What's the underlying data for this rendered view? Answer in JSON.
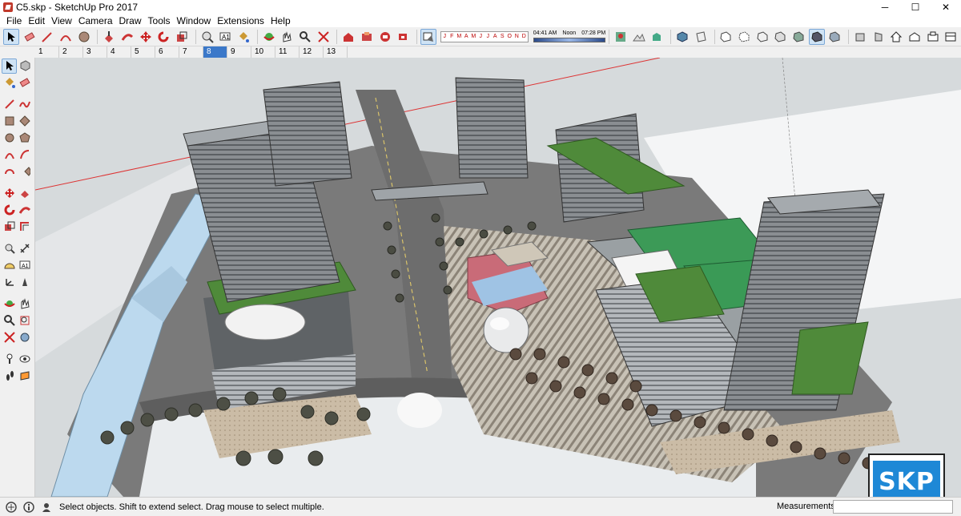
{
  "window": {
    "title": "C5.skp - SketchUp Pro 2017",
    "controls": {
      "minimize": "─",
      "maximize": "☐",
      "close": "✕"
    }
  },
  "menu": [
    "File",
    "Edit",
    "View",
    "Camera",
    "Draw",
    "Tools",
    "Window",
    "Extensions",
    "Help"
  ],
  "toolbar": {
    "months": [
      "J",
      "F",
      "M",
      "A",
      "M",
      "J",
      "J",
      "A",
      "S",
      "O",
      "N",
      "D"
    ],
    "time_left": "04:41 AM",
    "time_mid": "Noon",
    "time_right": "07:28 PM"
  },
  "scenes": {
    "tabs": [
      "1",
      "2",
      "3",
      "4",
      "5",
      "6",
      "7",
      "8",
      "9",
      "10",
      "11",
      "12",
      "13"
    ],
    "active": "8"
  },
  "status": {
    "hint": "Select objects. Shift to extend select. Drag mouse to select multiple.",
    "measurements_label": "Measurements",
    "measurements_value": ""
  },
  "watermark": {
    "text": "SKP"
  },
  "colors": {
    "accent": "#3b78c9",
    "ground": "#e9eef1",
    "water": "#bcd9ee",
    "road": "#6f6f6f",
    "grass": "#4f8a3a",
    "skp_blue": "#1e88d6"
  }
}
